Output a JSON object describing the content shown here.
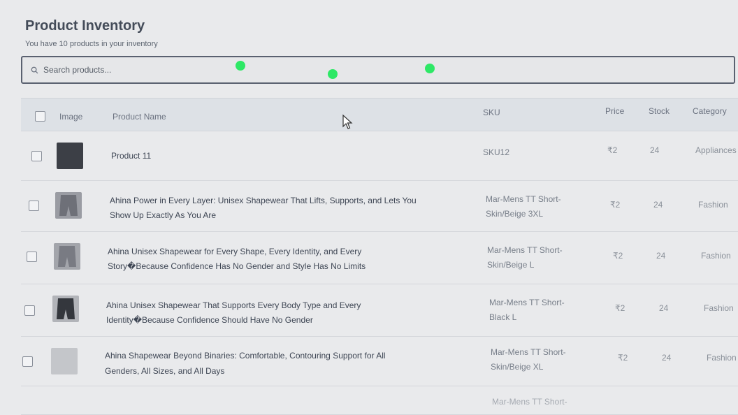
{
  "header": {
    "title": "Product Inventory",
    "subtitle": "You have 10 products in your inventory"
  },
  "search": {
    "placeholder": "Search products..."
  },
  "table": {
    "columns": {
      "image": "Image",
      "name": "Product Name",
      "sku": "SKU",
      "price": "Price",
      "stock": "Stock",
      "category": "Category"
    },
    "rows": [
      {
        "name_line1": "Product 11",
        "name_line2": "",
        "sku_line1": "SKU12",
        "sku_line2": "",
        "price": "₹2",
        "stock": "24",
        "category": "Appliances"
      },
      {
        "name_line1": "Ahina Power in Every Layer: Unisex Shapewear That Lifts, Supports, and Lets You",
        "name_line2": "Show Up Exactly As You Are",
        "sku_line1": "Mar-Mens TT Short-",
        "sku_line2": "Skin/Beige 3XL",
        "price": "₹2",
        "stock": "24",
        "category": "Fashion"
      },
      {
        "name_line1": "Ahina Unisex Shapewear for Every Shape, Every Identity, and Every",
        "name_line2": "Story�Because Confidence Has No Gender and Style Has No Limits",
        "sku_line1": "Mar-Mens TT Short-",
        "sku_line2": "Skin/Beige L",
        "price": "₹2",
        "stock": "24",
        "category": "Fashion"
      },
      {
        "name_line1": "Ahina Unisex Shapewear That Supports Every Body Type and Every",
        "name_line2": "Identity�Because Confidence Should Have No Gender",
        "sku_line1": "Mar-Mens TT Short-",
        "sku_line2": "Black L",
        "price": "₹2",
        "stock": "24",
        "category": "Fashion"
      },
      {
        "name_line1": "Ahina Shapewear Beyond Binaries: Comfortable, Contouring Support for All",
        "name_line2": "Genders, All Sizes, and All Days",
        "sku_line1": "Mar-Mens TT Short-",
        "sku_line2": "Skin/Beige XL",
        "price": "₹2",
        "stock": "24",
        "category": "Fashion"
      },
      {
        "name_line1": "",
        "name_line2": "",
        "sku_line1": "Mar-Mens TT Short-",
        "sku_line2": "",
        "price": "",
        "stock": "",
        "category": ""
      }
    ]
  },
  "colors": {
    "status_dot": "#2ee866",
    "search_border": "#5a6170",
    "header_bg": "#dde1e6"
  },
  "icons": {
    "search": "search-icon",
    "cursor": "cursor-arrow-icon"
  }
}
